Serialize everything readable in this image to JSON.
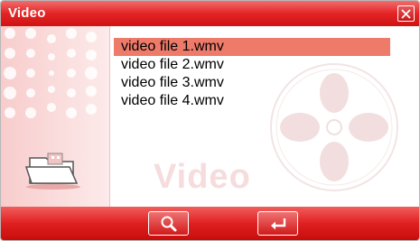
{
  "window": {
    "title": "Video"
  },
  "files": {
    "items": [
      {
        "label": "video file 1.wmv",
        "selected": true
      },
      {
        "label": "video file 2.wmv",
        "selected": false
      },
      {
        "label": "video file 3.wmv",
        "selected": false
      },
      {
        "label": "video file 4.wmv",
        "selected": false
      }
    ]
  },
  "watermark": {
    "text": "Video"
  },
  "icons": {
    "close": "close-icon",
    "folder": "folder-icon",
    "search": "search-icon",
    "enter": "enter-icon",
    "film_reel": "film-reel-icon",
    "dots": "dots-pattern-icon"
  },
  "colors": {
    "title_bar": "#e42424",
    "selection": "#ee7a6a",
    "side_panel": "#f8cccc",
    "watermark": "#f6dcdc"
  }
}
